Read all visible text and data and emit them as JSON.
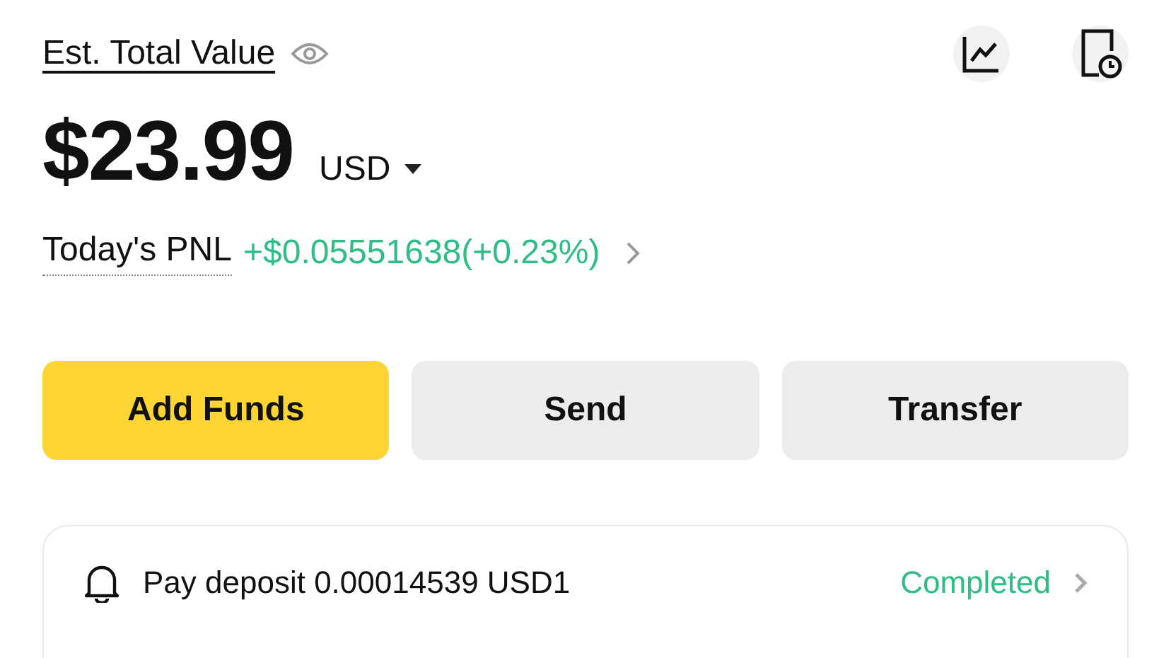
{
  "header": {
    "title": "Est. Total Value"
  },
  "balance": {
    "amount": "$23.99",
    "currency": "USD"
  },
  "pnl": {
    "label": "Today's PNL",
    "value": "+$0.05551638(+0.23%)"
  },
  "actions": [
    {
      "label": "Add Funds",
      "kind": "primary"
    },
    {
      "label": "Send",
      "kind": "secondary"
    },
    {
      "label": "Transfer",
      "kind": "secondary"
    }
  ],
  "notice": {
    "text": "Pay deposit 0.00014539 USD1",
    "status": "Completed"
  }
}
